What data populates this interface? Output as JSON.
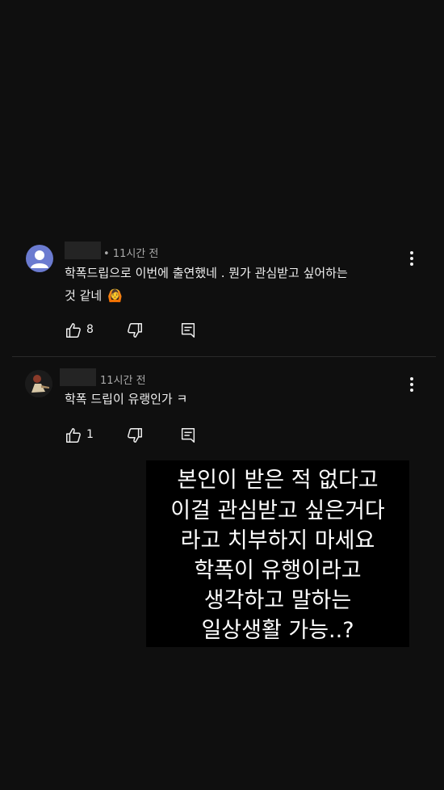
{
  "comments": [
    {
      "time": "• 11시간 전",
      "line1": "학폭드립으로  이번에 출연했네 . 뭔가 관심받고 싶어하는",
      "line2": "것 같네",
      "emoji": "🙆",
      "likes": "8"
    },
    {
      "time": "11시간 전",
      "line1": "학폭 드립이 유랭인가 ㅋ",
      "likes": "1"
    }
  ],
  "overlay": {
    "lines": [
      "본인이 받은 적 없다고",
      "이걸 관심받고 싶은거다",
      "라고 치부하지 마세요",
      "학폭이 유행이라고",
      "생각하고 말하는",
      "일상생활 가능..?"
    ]
  },
  "icons": {
    "like": "thumb-up-icon",
    "dislike": "thumb-down-icon",
    "reply": "reply-icon",
    "more": "more-vert-icon"
  },
  "colors": {
    "background": "#0f0f0f",
    "avatar_default": "#6b7bd0",
    "text_secondary": "#aaaaaa"
  }
}
